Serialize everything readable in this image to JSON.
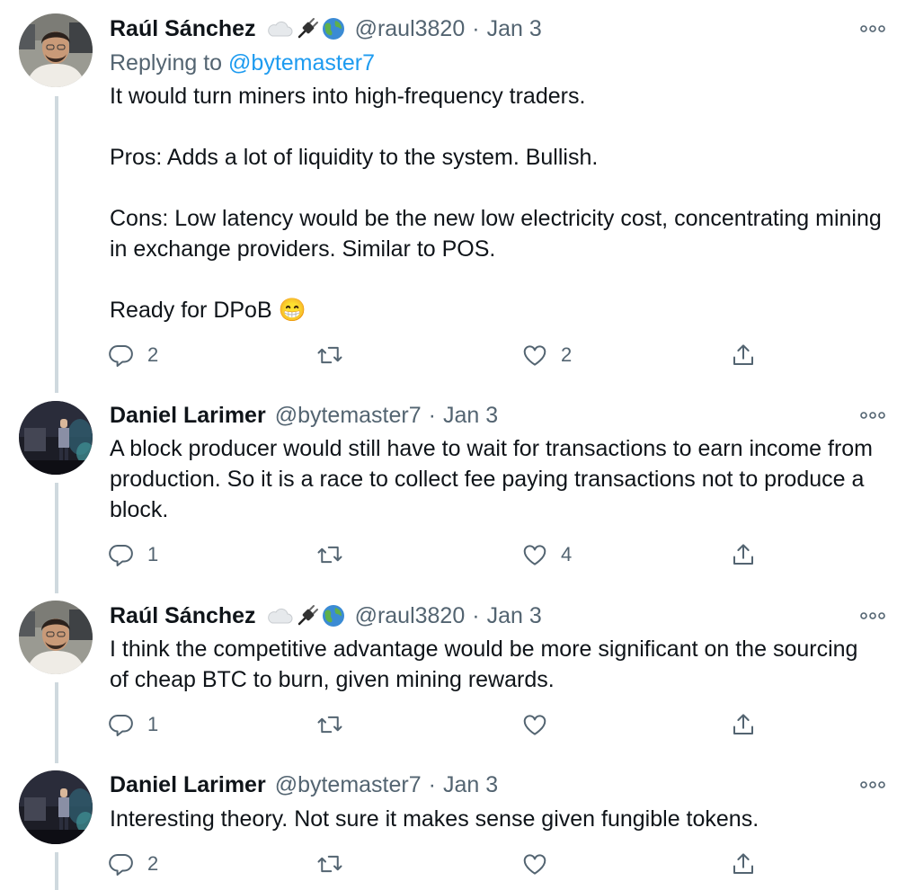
{
  "tweets": [
    {
      "name": "Raúl Sánchez",
      "handle": "@raul3820",
      "dot": "·",
      "date": "Jan 3",
      "replying_prefix": "Replying to",
      "replying_to": "@bytemaster7",
      "text": [
        "It would turn miners into high-frequency traders.",
        "Pros: Adds a lot of liquidity to the system. Bullish.",
        "Cons: Low latency would be the new low electricity cost, concentrating mining in exchange providers. Similar to POS.",
        "Ready for DPoB 😁"
      ],
      "replies": "2",
      "retweets": "",
      "likes": "2"
    },
    {
      "name": "Daniel Larimer",
      "handle": "@bytemaster7",
      "dot": "·",
      "date": "Jan 3",
      "text": [
        "A block producer would still have to wait for transactions to earn income from production. So it is a race to collect fee paying transactions not to produce a block."
      ],
      "replies": "1",
      "retweets": "",
      "likes": "4"
    },
    {
      "name": "Raúl Sánchez",
      "handle": "@raul3820",
      "dot": "·",
      "date": "Jan 3",
      "text": [
        "I think the competitive advantage would be more significant on the sourcing of cheap BTC to burn, given mining rewards."
      ],
      "replies": "1",
      "retweets": "",
      "likes": ""
    },
    {
      "name": "Daniel Larimer",
      "handle": "@bytemaster7",
      "dot": "·",
      "date": "Jan 3",
      "text": [
        "Interesting theory. Not sure it makes sense given fungible tokens."
      ],
      "replies": "2",
      "retweets": "",
      "likes": ""
    }
  ],
  "icons": {
    "reply": "speech-bubble",
    "retweet": "retweet-arrows",
    "like": "heart",
    "share": "share-up-arrow",
    "more": "three-dots",
    "badges": [
      "cloud",
      "plug",
      "globe"
    ]
  },
  "colors": {
    "link": "#1d9bf0",
    "secondary": "#536471",
    "thread_line": "#cfd9de"
  }
}
